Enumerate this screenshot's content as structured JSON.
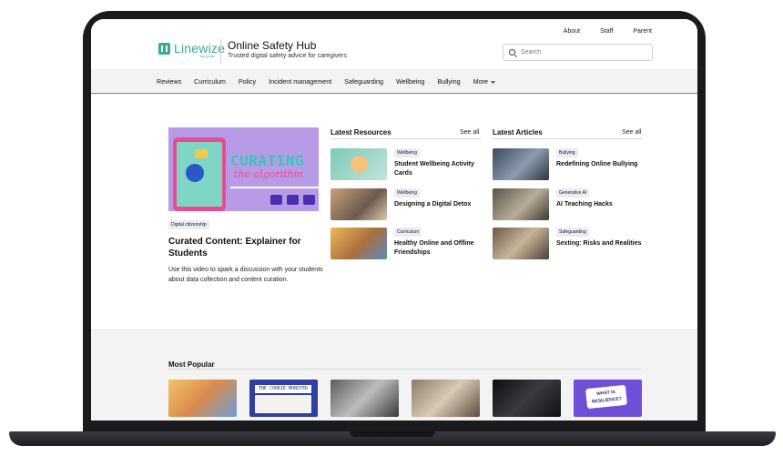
{
  "header": {
    "logo_text": "Linewize",
    "logo_sub": "by Qoria",
    "site_title": "Online Safety Hub",
    "site_tagline": "Trusted digital safety advice for caregivers",
    "top_links": [
      "About",
      "Staff",
      "Parent"
    ],
    "search_placeholder": "Search"
  },
  "nav": {
    "items": [
      "Reviews",
      "Curriculum",
      "Policy",
      "Incident management",
      "Safeguarding",
      "Wellbeing",
      "Bullying",
      "More"
    ]
  },
  "feature": {
    "image_title_1": "CURATING",
    "image_title_2": "the algorithm",
    "tag": "Digital citizenship",
    "title": "Curated Content: Explainer for Students",
    "description": "Use this video to spark a discussion with your students about data collection and content curation."
  },
  "resources": {
    "heading": "Latest Resources",
    "see_all": "See all",
    "items": [
      {
        "tag": "Wellbeing",
        "title": "Student Wellbeing Activity Cards"
      },
      {
        "tag": "Wellbeing",
        "title": "Designing a Digital Detox"
      },
      {
        "tag": "Curriculum",
        "title": "Healthy Online and Offline Friendships"
      }
    ]
  },
  "articles": {
    "heading": "Latest Articles",
    "see_all": "See all",
    "items": [
      {
        "tag": "Bullying",
        "title": "Redefining Online Bullying"
      },
      {
        "tag": "Generative AI",
        "title": "AI Teaching Hacks"
      },
      {
        "tag": "Safeguarding",
        "title": "Sexting: Risks and Realities"
      }
    ]
  },
  "popular": {
    "heading": "Most Popular",
    "thumb_2_label": "THE COOKIE MONSTER",
    "thumb_6_label": "WHAT IS RESILIENCE?"
  },
  "colors": {
    "brand": "#3aaa8c",
    "nav_bg": "#f3f3f3",
    "tag_bg": "#e9ecf2"
  }
}
